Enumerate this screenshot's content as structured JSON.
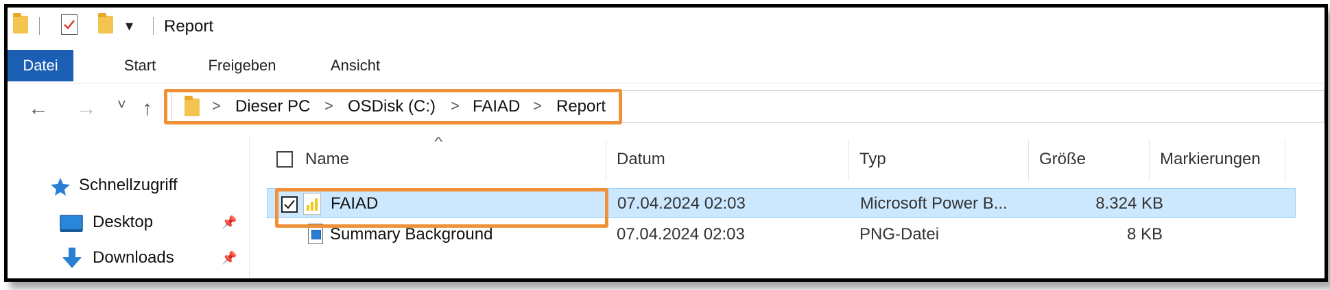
{
  "window": {
    "title": "Report"
  },
  "ribbon": {
    "tabs": [
      "Datei",
      "Start",
      "Freigeben",
      "Ansicht"
    ]
  },
  "address": {
    "crumbs": [
      "Dieser PC",
      "OSDisk (C:)",
      "FAIAD",
      "Report"
    ],
    "separator": ">"
  },
  "nav_buttons": {
    "back": "←",
    "forward": "→",
    "recent": "˅",
    "up": "↑"
  },
  "sidebar": {
    "items": [
      {
        "label": "Schnellzugriff",
        "icon": "star-icon"
      },
      {
        "label": "Desktop",
        "icon": "desktop-icon",
        "pinned": true
      },
      {
        "label": "Downloads",
        "icon": "download-arrow-icon",
        "pinned": true
      }
    ]
  },
  "columns": [
    "Name",
    "Datum",
    "Typ",
    "Größe",
    "Markierungen"
  ],
  "files": [
    {
      "name": "FAIAD",
      "date": "07.04.2024 02:03",
      "type": "Microsoft Power B...",
      "size": "8.324 KB",
      "selected": true,
      "icon": "power-bi-file-icon"
    },
    {
      "name": "Summary Background",
      "date": "07.04.2024 02:03",
      "type": "PNG-Datei",
      "size": "8 KB",
      "selected": false,
      "icon": "png-file-icon"
    }
  ],
  "colors": {
    "ribbon_file_tab": "#1a5fb4",
    "highlight_outline": "#f0913a",
    "selection_bg": "#cce8ff",
    "folder": "#f3c450"
  }
}
